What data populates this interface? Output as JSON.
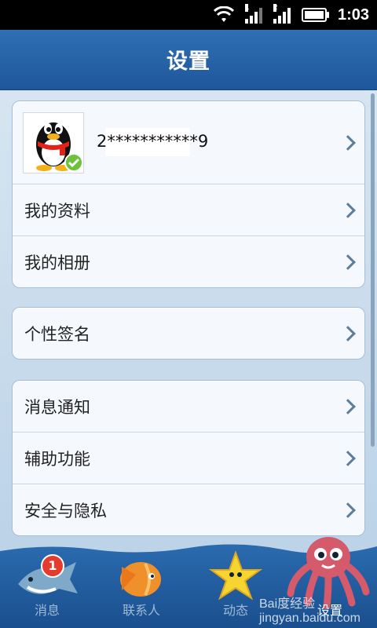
{
  "status_bar": {
    "time": "1:03",
    "signal_1_label": "1",
    "signal_2_label": "2"
  },
  "header": {
    "title": "设置"
  },
  "profile": {
    "account_masked": "2***********9",
    "avatar": "qq-penguin-avatar",
    "online_status": "online-check-icon"
  },
  "group1": [
    {
      "label": "我的资料"
    },
    {
      "label": "我的相册"
    }
  ],
  "group2": [
    {
      "label": "个性签名"
    }
  ],
  "group3": [
    {
      "label": "消息通知"
    },
    {
      "label": "辅助功能"
    },
    {
      "label": "安全与隐私"
    }
  ],
  "tabs": [
    {
      "label": "消息",
      "icon": "shark-icon",
      "badge": "1"
    },
    {
      "label": "联系人",
      "icon": "fish-icon"
    },
    {
      "label": "动态",
      "icon": "starfish-icon"
    },
    {
      "label": "设置",
      "icon": "octopus-icon",
      "active": true
    }
  ],
  "watermark": "Bai度经验 jingyan.baidu.com",
  "colors": {
    "header_blue": "#2461a6",
    "tab_blue": "#1f5b9c",
    "badge_red": "#e43b2e",
    "online_green": "#6cc23a"
  }
}
